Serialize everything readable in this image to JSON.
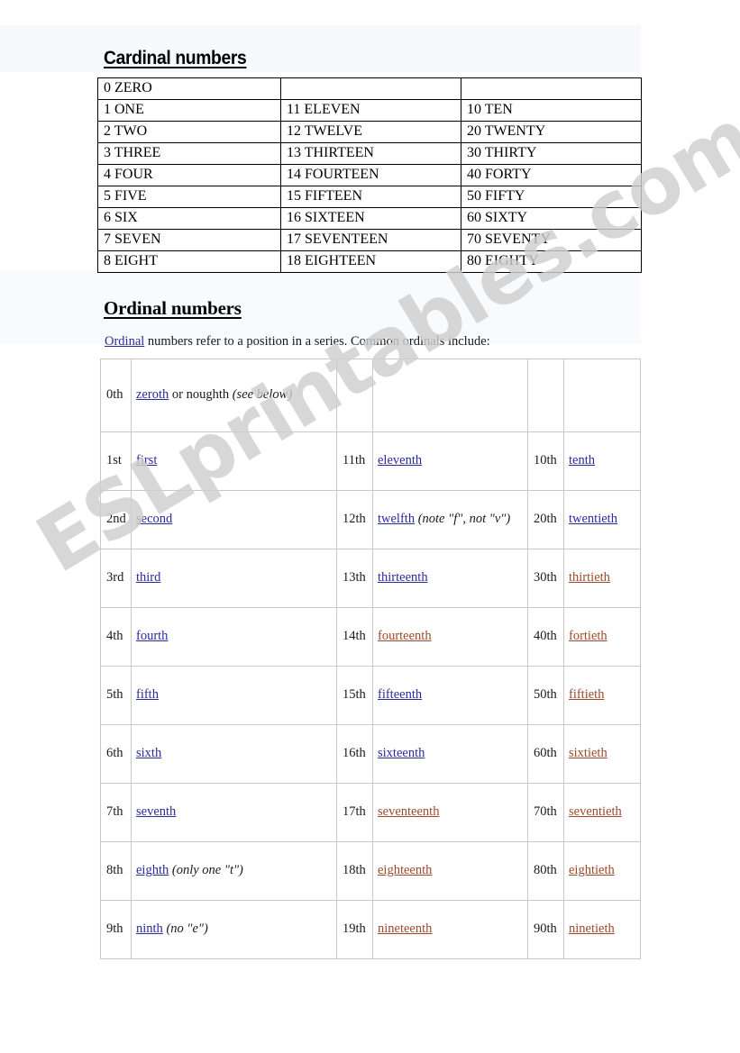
{
  "document": {
    "watermark": "ESLprintables.com"
  },
  "cardinal": {
    "title": "Cardinal numbers",
    "rows": [
      {
        "c1": "0 ZERO",
        "c2": "",
        "c3": ""
      },
      {
        "c1": "1 ONE",
        "c2": "11 ELEVEN",
        "c3": "10 TEN"
      },
      {
        "c1": "2 TWO",
        "c2": "12 TWELVE",
        "c3": "20 TWENTY"
      },
      {
        "c1": "3 THREE",
        "c2": "13 THIRTEEN",
        "c3": "30 THIRTY"
      },
      {
        "c1": "4 FOUR",
        "c2": "14 FOURTEEN",
        "c3": "40 FORTY"
      },
      {
        "c1": "5 FIVE",
        "c2": "15 FIFTEEN",
        "c3": "50 FIFTY"
      },
      {
        "c1": "6 SIX",
        "c2": "16 SIXTEEN",
        "c3": "60 SIXTY"
      },
      {
        "c1": "7 SEVEN",
        "c2": "17 SEVENTEEN",
        "c3": "70 SEVENTY"
      },
      {
        "c1": "8 EIGHT",
        "c2": "18 EIGHTEEN",
        "c3": "80 EIGHTY"
      }
    ]
  },
  "ordinal": {
    "title": "Ordinal numbers",
    "intro_link": "Ordinal",
    "intro_rest": " numbers refer to a position in a series. Common ordinals include:",
    "rows": [
      {
        "n1": "0th",
        "w1_link": "zeroth",
        "w1_after": " or noughth ",
        "w1_note": "(see below)",
        "w1_color": "#2b2ba0",
        "n2": "",
        "w2_link": "",
        "w2_note": "",
        "w2_color": "#2b2ba0",
        "n3": "",
        "w3_link": "",
        "w3_color": "#2b2ba0"
      },
      {
        "n1": "1st",
        "w1_link": "first",
        "w1_after": "",
        "w1_note": "",
        "w1_color": "#2b2ba0",
        "n2": "11th",
        "w2_link": "eleventh",
        "w2_note": "",
        "w2_color": "#2b2ba0",
        "n3": "10th",
        "w3_link": "tenth",
        "w3_color": "#2b2ba0"
      },
      {
        "n1": "2nd",
        "w1_link": "second",
        "w1_after": "",
        "w1_note": "",
        "w1_color": "#2b2ba0",
        "n2": "12th",
        "w2_link": "twelfth",
        "w2_note": " (note \"f\", not \"v\")",
        "w2_color": "#2b2ba0",
        "n3": "20th",
        "w3_link": "twentieth",
        "w3_color": "#2b2ba0"
      },
      {
        "n1": "3rd",
        "w1_link": "third",
        "w1_after": "",
        "w1_note": "",
        "w1_color": "#2b2ba0",
        "n2": "13th",
        "w2_link": "thirteenth",
        "w2_note": "",
        "w2_color": "#2b2ba0",
        "n3": "30th",
        "w3_link": "thirtieth",
        "w3_color": "#9c4a2a"
      },
      {
        "n1": "4th",
        "w1_link": "fourth",
        "w1_after": "",
        "w1_note": "",
        "w1_color": "#2b2ba0",
        "n2": "14th",
        "w2_link": "fourteenth",
        "w2_note": "",
        "w2_color": "#9c4a2a",
        "n3": "40th",
        "w3_link": "fortieth",
        "w3_color": "#9c4a2a"
      },
      {
        "n1": "5th",
        "w1_link": "fifth",
        "w1_after": "",
        "w1_note": "",
        "w1_color": "#2b2ba0",
        "n2": "15th",
        "w2_link": "fifteenth",
        "w2_note": "",
        "w2_color": "#2b2ba0",
        "n3": "50th",
        "w3_link": "fiftieth",
        "w3_color": "#9c4a2a"
      },
      {
        "n1": "6th",
        "w1_link": "sixth",
        "w1_after": "",
        "w1_note": "",
        "w1_color": "#2b2ba0",
        "n2": "16th",
        "w2_link": "sixteenth",
        "w2_note": "",
        "w2_color": "#2b2ba0",
        "n3": "60th",
        "w3_link": "sixtieth",
        "w3_color": "#9c4a2a"
      },
      {
        "n1": "7th",
        "w1_link": "seventh",
        "w1_after": "",
        "w1_note": "",
        "w1_color": "#2b2ba0",
        "n2": "17th",
        "w2_link": "seventeenth",
        "w2_note": "",
        "w2_color": "#9c4a2a",
        "n3": "70th",
        "w3_link": "seventieth",
        "w3_color": "#9c4a2a"
      },
      {
        "n1": "8th",
        "w1_link": "eighth",
        "w1_after": " ",
        "w1_note": "(only one \"t\")",
        "w1_color": "#2b2ba0",
        "n2": "18th",
        "w2_link": "eighteenth",
        "w2_note": "",
        "w2_color": "#9c4a2a",
        "n3": "80th",
        "w3_link": "eightieth",
        "w3_color": "#9c4a2a"
      },
      {
        "n1": "9th",
        "w1_link": "ninth",
        "w1_after": " ",
        "w1_note": "(no \"e\")",
        "w1_color": "#2b2ba0",
        "n2": "19th",
        "w2_link": "nineteenth",
        "w2_note": "",
        "w2_color": "#9c4a2a",
        "n3": "90th",
        "w3_link": "ninetieth",
        "w3_color": "#9c4a2a"
      }
    ]
  },
  "colors": {
    "link_unvisited": "#2b2ba0",
    "link_visited": "#9c4a2a",
    "cardinal_border": "#000000",
    "ordinal_border": "#c8c8c8",
    "watermark": "#cfcfcf"
  }
}
